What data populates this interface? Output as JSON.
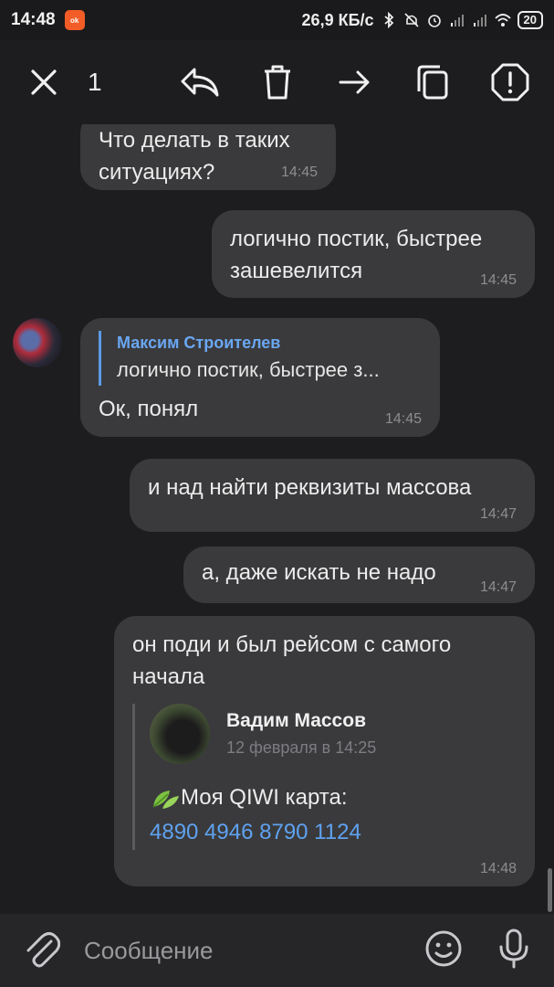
{
  "status_bar": {
    "time": "14:48",
    "net_speed": "26,9 КБ/с",
    "battery": "20"
  },
  "toolbar": {
    "selected_count": "1"
  },
  "messages": [
    {
      "side": "in",
      "text": "Что делать в таких ситуациях?",
      "time": "14:45"
    },
    {
      "side": "out",
      "text": "логично постик, быстрее зашевелится",
      "time": "14:45"
    },
    {
      "side": "in",
      "reply_name": "Максим Строителев",
      "reply_text": "логично постик, быстрее з...",
      "text": "Ок, понял",
      "time": "14:45"
    },
    {
      "side": "out",
      "text": "и над найти реквизиты массова",
      "time": "14:47"
    },
    {
      "side": "out",
      "text": "а, даже искать не надо",
      "time": "14:47"
    },
    {
      "side": "out",
      "text": "он поди и был рейсом с самого начала",
      "time": "14:48",
      "forward": {
        "name": "Вадим Массов",
        "date": "12 февраля в 14:25",
        "body": "Моя QIWI карта:",
        "link": "4890 4946 8790 1124"
      }
    }
  ],
  "input": {
    "placeholder": "Сообщение"
  },
  "colors": {
    "background": "#1d1d1f",
    "bubble": "#3a3a3c",
    "accent": "#5fa2f0"
  },
  "icons": [
    "close-icon",
    "reply-icon",
    "trash-icon",
    "forward-icon",
    "copy-icon",
    "report-icon",
    "attach-icon",
    "emoji-icon",
    "mic-icon"
  ]
}
